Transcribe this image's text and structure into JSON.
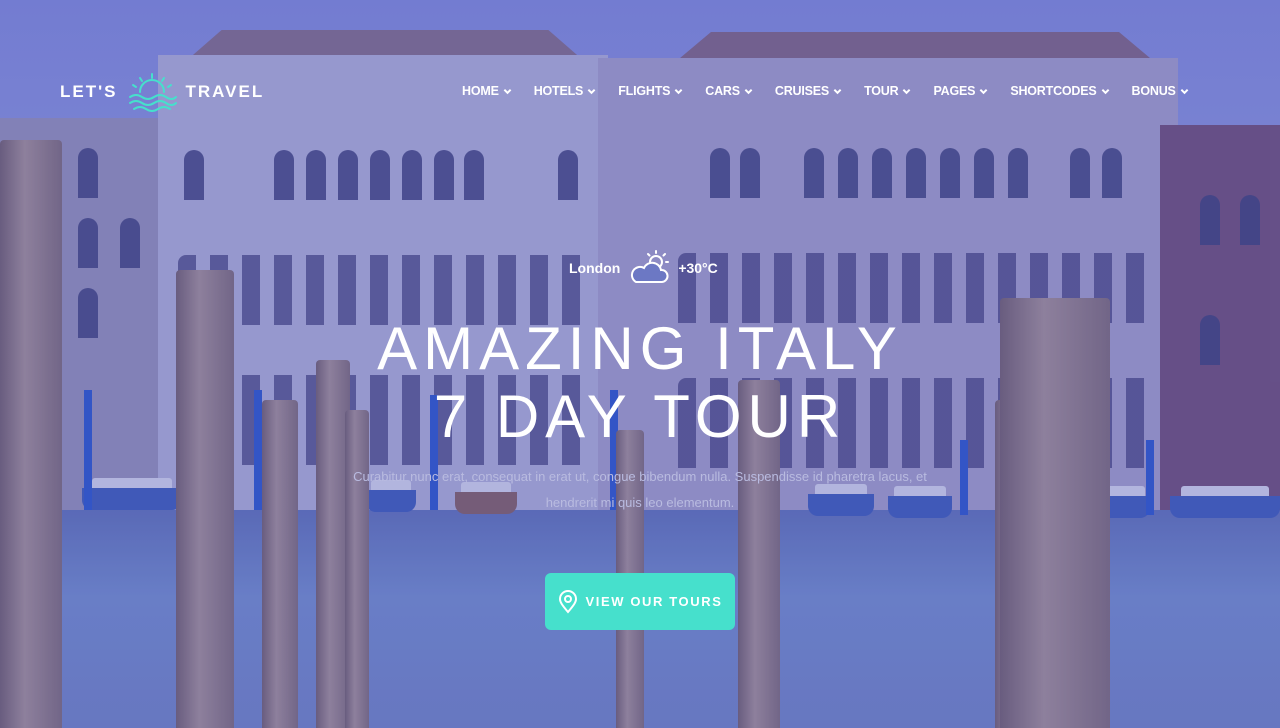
{
  "brand": {
    "word_left": "LET'S",
    "word_right": "TRAVEL",
    "logo_icon": "sunset-waves-icon",
    "accent_color": "#46e0cc"
  },
  "nav": {
    "items": [
      {
        "label": "HOME"
      },
      {
        "label": "HOTELS"
      },
      {
        "label": "FLIGHTS"
      },
      {
        "label": "CARS"
      },
      {
        "label": "CRUISES"
      },
      {
        "label": "TOUR"
      },
      {
        "label": "PAGES"
      },
      {
        "label": "SHORTCODES"
      },
      {
        "label": "BONUS"
      }
    ],
    "dropdown_icon": "chevron-down-icon"
  },
  "weather": {
    "city": "London",
    "temperature": "+30°C",
    "icon": "sun-cloud-icon"
  },
  "hero": {
    "title_line1": "AMAZING ITALY",
    "title_line2": "7 DAY TOUR",
    "description": "Curabitur nunc erat, consequat in erat ut, congue bibendum nulla. Suspendisse id pharetra lacus, et hendrerit mi quis leo elementum."
  },
  "cta": {
    "label": "VIEW OUR TOURS",
    "icon": "map-pin-icon",
    "color": "#46e0cc"
  }
}
